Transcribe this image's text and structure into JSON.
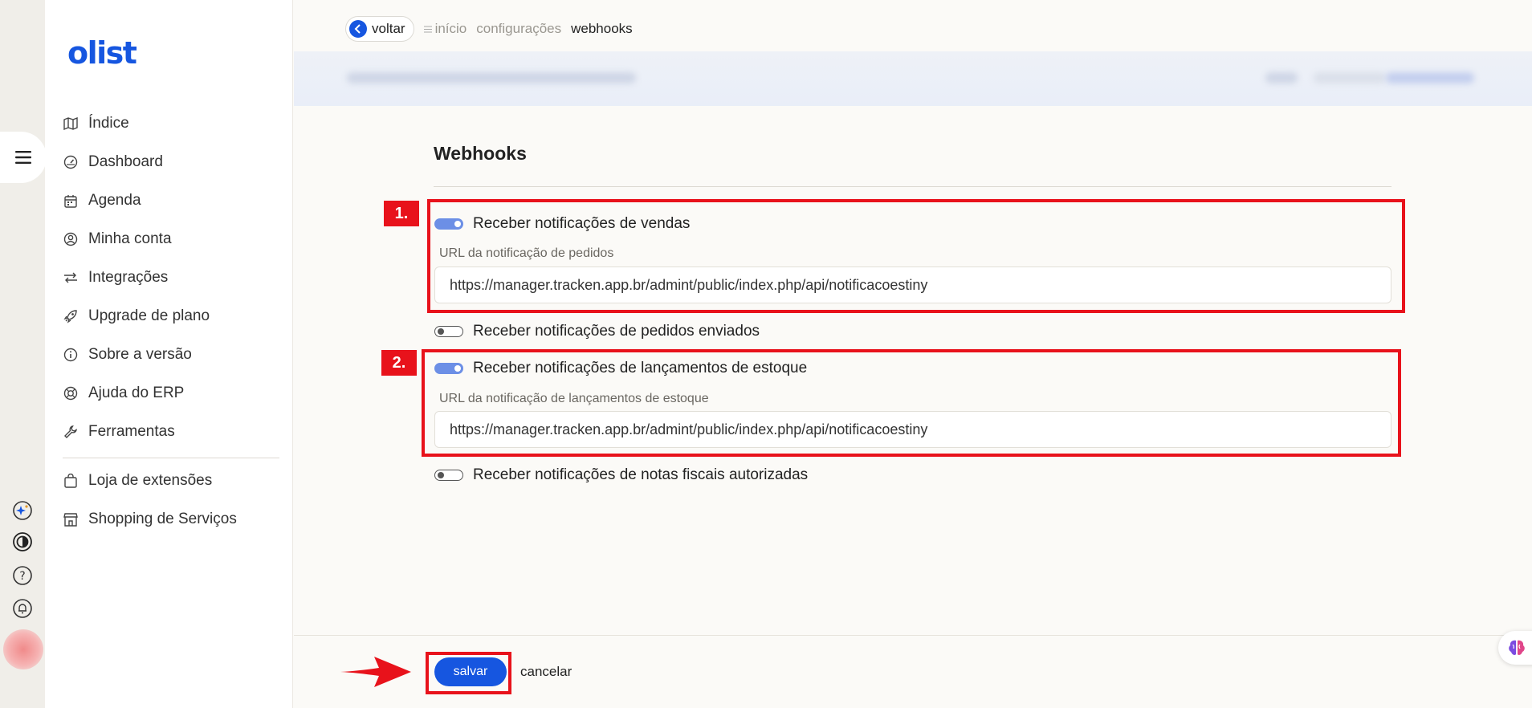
{
  "brand": {
    "logo_text": "olist",
    "accent": "#1656e0"
  },
  "breadcrumb": {
    "back_label": "voltar",
    "items": [
      "início",
      "configurações",
      "webhooks"
    ]
  },
  "sidebar": {
    "items": [
      {
        "label": "Índice",
        "icon": "map-icon"
      },
      {
        "label": "Dashboard",
        "icon": "gauge-icon"
      },
      {
        "label": "Agenda",
        "icon": "calendar-icon"
      },
      {
        "label": "Minha conta",
        "icon": "user-circle-icon"
      },
      {
        "label": "Integrações",
        "icon": "arrows-swap-icon"
      },
      {
        "label": "Upgrade de plano",
        "icon": "rocket-icon"
      },
      {
        "label": "Sobre a versão",
        "icon": "info-icon"
      },
      {
        "label": "Ajuda do ERP",
        "icon": "lifebuoy-icon"
      },
      {
        "label": "Ferramentas",
        "icon": "wrench-icon"
      }
    ],
    "secondary_items": [
      {
        "label": "Loja de extensões",
        "icon": "shopping-bag-icon"
      },
      {
        "label": "Shopping de Serviços",
        "icon": "storefront-icon"
      }
    ]
  },
  "page": {
    "title": "Webhooks",
    "toggles": [
      {
        "label": "Receber notificações de vendas",
        "enabled": true,
        "field_label": "URL da notificação de pedidos",
        "url": "https://manager.tracken.app.br/admint/public/index.php/api/notificacoestiny"
      },
      {
        "label": "Receber notificações de pedidos enviados",
        "enabled": false
      },
      {
        "label": "Receber notificações de lançamentos de estoque",
        "enabled": true,
        "field_label": "URL da notificação de lançamentos de estoque",
        "url": "https://manager.tracken.app.br/admint/public/index.php/api/notificacoestiny"
      },
      {
        "label": "Receber notificações de notas fiscais autorizadas",
        "enabled": false
      }
    ]
  },
  "annotations": {
    "step_1": "1.",
    "step_2": "2.",
    "color": "#e8121b"
  },
  "footer": {
    "save_label": "salvar",
    "cancel_label": "cancelar"
  }
}
